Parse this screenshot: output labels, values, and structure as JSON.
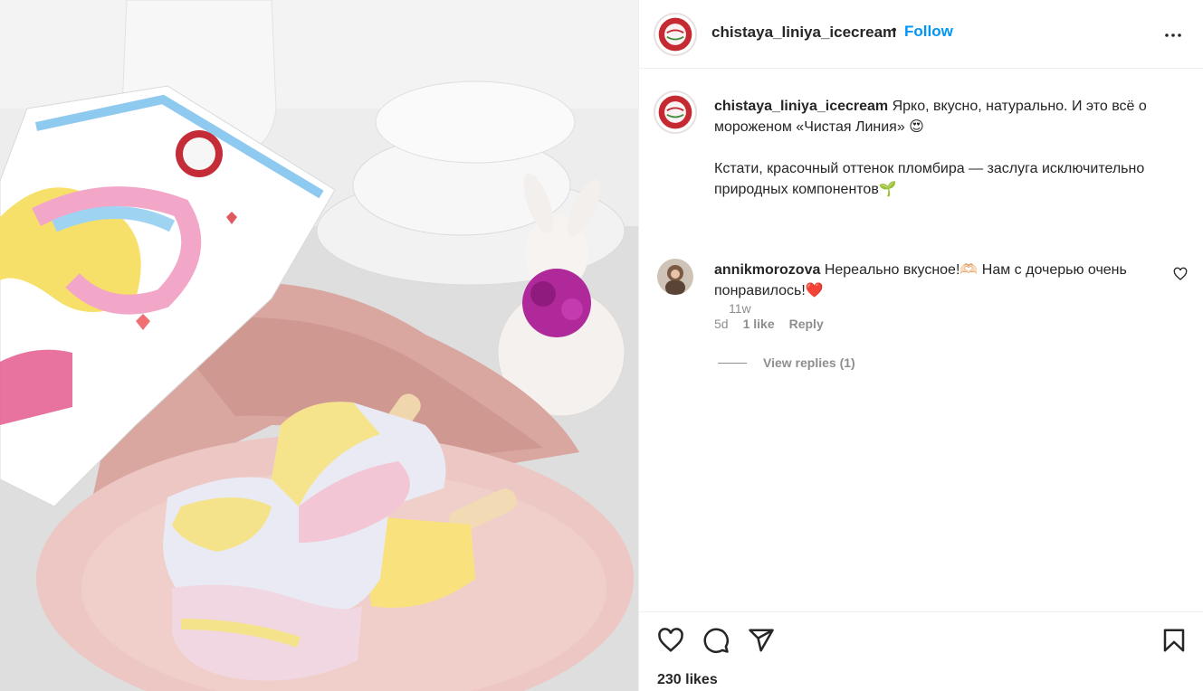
{
  "post": {
    "author": "chistaya_liniya_icecream",
    "separator": "•",
    "follow_label": "Follow",
    "more_icon": "more-horizontal-icon"
  },
  "caption": {
    "author": "chistaya_liniya_icecream",
    "line1": "Ярко, вкусно, натурально. И это всё о мороженом «Чистая Линия» 😍",
    "line2": "Кстати, красочный оттенок пломбира — заслуга исключительно природных компонентов🌱",
    "time": "11w"
  },
  "comments": [
    {
      "author": "annikmorozova",
      "text": "Нереально вкусное!🫶🏻 Нам с дочерью очень понравилось!❤️",
      "time": "5d",
      "likes": "1 like",
      "reply_label": "Reply",
      "view_replies": "View replies (1)"
    }
  ],
  "actions": {
    "like_icon": "heart-icon",
    "comment_icon": "comment-icon",
    "share_icon": "share-icon",
    "save_icon": "bookmark-icon",
    "likes_text": "230 likes"
  },
  "colors": {
    "link": "#0095f6",
    "muted": "#8e8e8e",
    "text": "#262626"
  }
}
